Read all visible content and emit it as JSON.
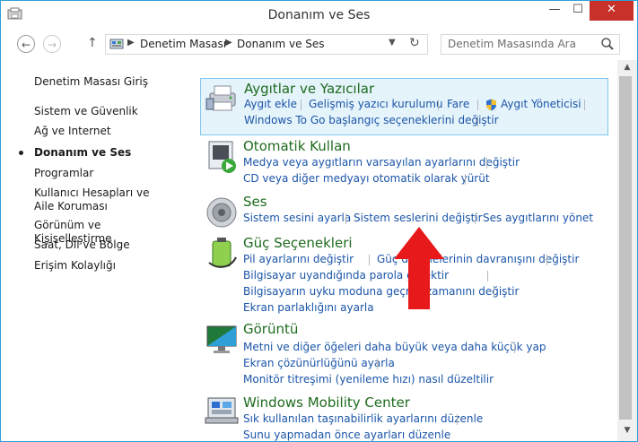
{
  "window": {
    "title": "Donanım ve Ses",
    "min_label": "—",
    "max_label": "☐",
    "close_label": "✕"
  },
  "nav": {
    "back_icon": "←",
    "forward_icon": "→",
    "up_icon": "↑",
    "breadcrumb": [
      "Denetim Masası",
      "Donanım ve Ses"
    ],
    "dropdown_icon": "▼",
    "refresh_icon": "↻",
    "search_placeholder": "Denetim Masasında Ara"
  },
  "sidebar": {
    "items": [
      {
        "label": "Denetim Masası Giriş"
      },
      {
        "label": "Sistem ve Güvenlik"
      },
      {
        "label": "Ağ ve Internet"
      },
      {
        "label": "Donanım ve Ses"
      },
      {
        "label": "Programlar"
      },
      {
        "label": "Kullanıcı Hesapları ve Aile Koruması"
      },
      {
        "label": "Görünüm ve Kişiselleştirme"
      },
      {
        "label": "Saat, Dil ve Bölge"
      },
      {
        "label": "Erişim Kolaylığı"
      }
    ]
  },
  "categories": [
    {
      "title": "Aygıtlar ve Yazıcılar",
      "icon": "printer-icon",
      "links": [
        "Aygıt ekle",
        "Gelişmiş yazıcı kurulumu",
        "Fare",
        "Aygıt Yöneticisi",
        "Windows To Go başlangıç seçeneklerini değiştir"
      ]
    },
    {
      "title": "Otomatik Kullan",
      "icon": "autoplay-icon",
      "links": [
        "Medya veya aygıtların varsayılan ayarlarını değiştir",
        "CD veya diğer medyayı otomatik olarak yürüt"
      ]
    },
    {
      "title": "Ses",
      "icon": "speaker-icon",
      "links": [
        "Sistem sesini ayarla",
        "Sistem seslerini değiştir",
        "Ses aygıtlarını yönet"
      ]
    },
    {
      "title": "Güç Seçenekleri",
      "icon": "battery-icon",
      "links": [
        "Pil ayarlarını değiştir",
        "Güç düğmelerinin davranışını değiştir",
        "Bilgisayar uyandığında parola gerektir",
        "Bilgisayarın uyku moduna geçme zamanını değiştir",
        "Ekran parlaklığını ayarla"
      ]
    },
    {
      "title": "Görüntü",
      "icon": "display-icon",
      "links": [
        "Metni ve diğer öğeleri daha büyük veya daha küçük yap",
        "Ekran çözünürlüğünü ayarla",
        "Monitör titreşimi (yenileme hızı) nasıl düzeltilir"
      ]
    },
    {
      "title": "Windows Mobility Center",
      "icon": "mobility-icon",
      "links": [
        "Sık kullanılan taşınabilirlik ayarlarını düzenle",
        "Sunu yapmadan önce ayarları düzenle"
      ]
    }
  ],
  "colors": {
    "title_green": "#1e6b1e",
    "link_blue": "#1a55a8",
    "highlight_bg": "#e5f3fb",
    "highlight_border": "#7ec7ee",
    "close_red": "#c7312a",
    "annotation_arrow": "#e8191a"
  }
}
